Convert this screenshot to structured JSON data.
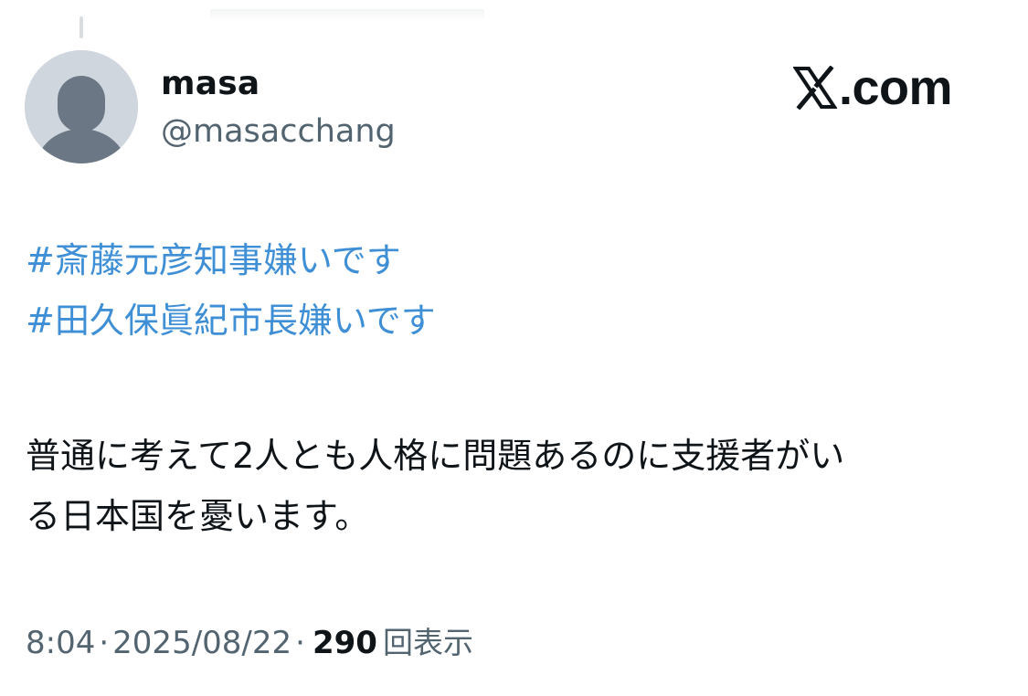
{
  "author": {
    "display_name": "masa",
    "handle": "@masacchang"
  },
  "brand": {
    "text": ".com",
    "icon": "x-logo-icon"
  },
  "tweet": {
    "hashtags": [
      "#斎藤元彦知事嫌いです",
      "#田久保眞紀市長嫌いです"
    ],
    "text_lines": [
      "普通に考えて2人とも人格に問題あるのに支援者がい",
      "る日本国を憂います。"
    ]
  },
  "meta": {
    "time": "8:04",
    "separator": "·",
    "date": "2025/08/22",
    "views_count": "290",
    "views_label": "回表示"
  },
  "colors": {
    "hashtag": "#3f8fd6",
    "secondary_text": "#536471",
    "primary_text": "#0f1419",
    "avatar_bg": "#cfd6de",
    "avatar_fg": "#6b7785"
  }
}
